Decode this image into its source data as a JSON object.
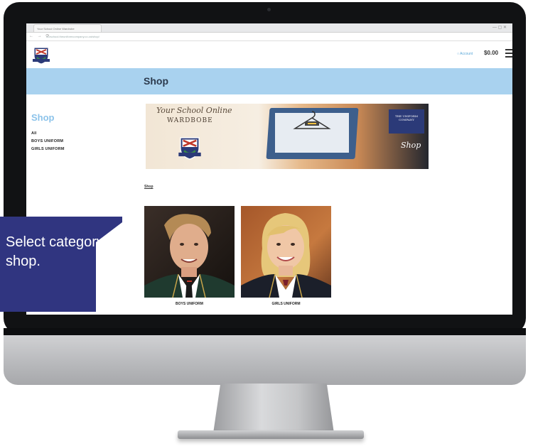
{
  "browser": {
    "tab_title": "Your School Online Wardrobe",
    "url": "ourschool.theuniformcompany.co.za/shop/"
  },
  "site": {
    "cart_account": "○ Account",
    "cart_total": "$0.00",
    "banner_title": "Shop"
  },
  "sidebar": {
    "title": "Shop",
    "items": [
      "All",
      "BOYS UNIFORM",
      "GIRLS UNIFORM"
    ]
  },
  "promo": {
    "script": "Your School Online",
    "wardrobe": "WARDBOBE",
    "uniform_company": "THE UNIFORM COMPANY",
    "shop": "Shop"
  },
  "breadcrumb": "Shop",
  "categories": [
    {
      "label": "BOYS UNIFORM"
    },
    {
      "label": "GIRLS UNIFORM"
    }
  ],
  "callout": {
    "text": "Select category to shop."
  },
  "colors": {
    "banner": "#a9d2ef",
    "sidebar_title": "#8cc3ea",
    "callout": "#303580",
    "blazer": "#1f3a2f"
  },
  "icons": [
    "crest-logo-icon",
    "hamburger-menu-icon",
    "hanger-icon"
  ]
}
